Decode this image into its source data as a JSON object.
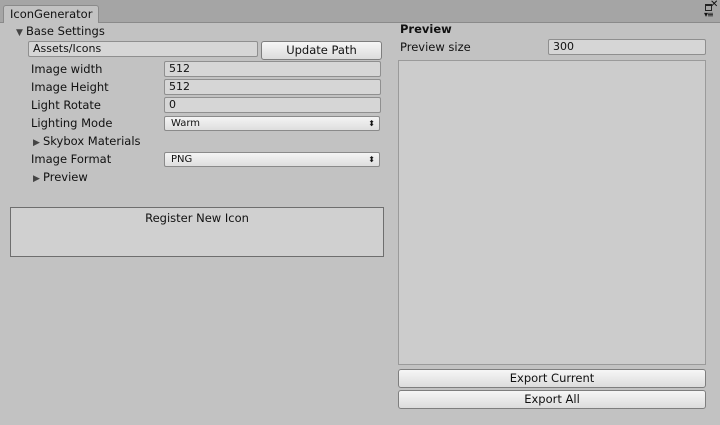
{
  "window": {
    "tab_title": "IconGenerator"
  },
  "base_settings": {
    "title": "Base Settings",
    "path_value": "Assets/Icons",
    "update_path_label": "Update Path",
    "fields": [
      {
        "label": "Image width",
        "value": "512"
      },
      {
        "label": "Image Height",
        "value": "512"
      },
      {
        "label": "Light Rotate",
        "value": "0"
      }
    ],
    "lighting_mode": {
      "label": "Lighting Mode",
      "selected": "Warm"
    },
    "skybox_label": "Skybox Materials",
    "image_format": {
      "label": "Image Format",
      "selected": "PNG"
    },
    "preview_fold_label": "Preview"
  },
  "register": {
    "title": "Register New Icon"
  },
  "preview_panel": {
    "title": "Preview",
    "size_label": "Preview size",
    "size_value": "300",
    "export_current_label": "Export Current",
    "export_all_label": "Export All"
  },
  "icons": {
    "foldout_expanded": "▼",
    "foldout_collapsed": "▶",
    "dropdown_caret": "⬍",
    "close": "✕",
    "maximize": "maximize-icon",
    "menu": "▾≡"
  }
}
